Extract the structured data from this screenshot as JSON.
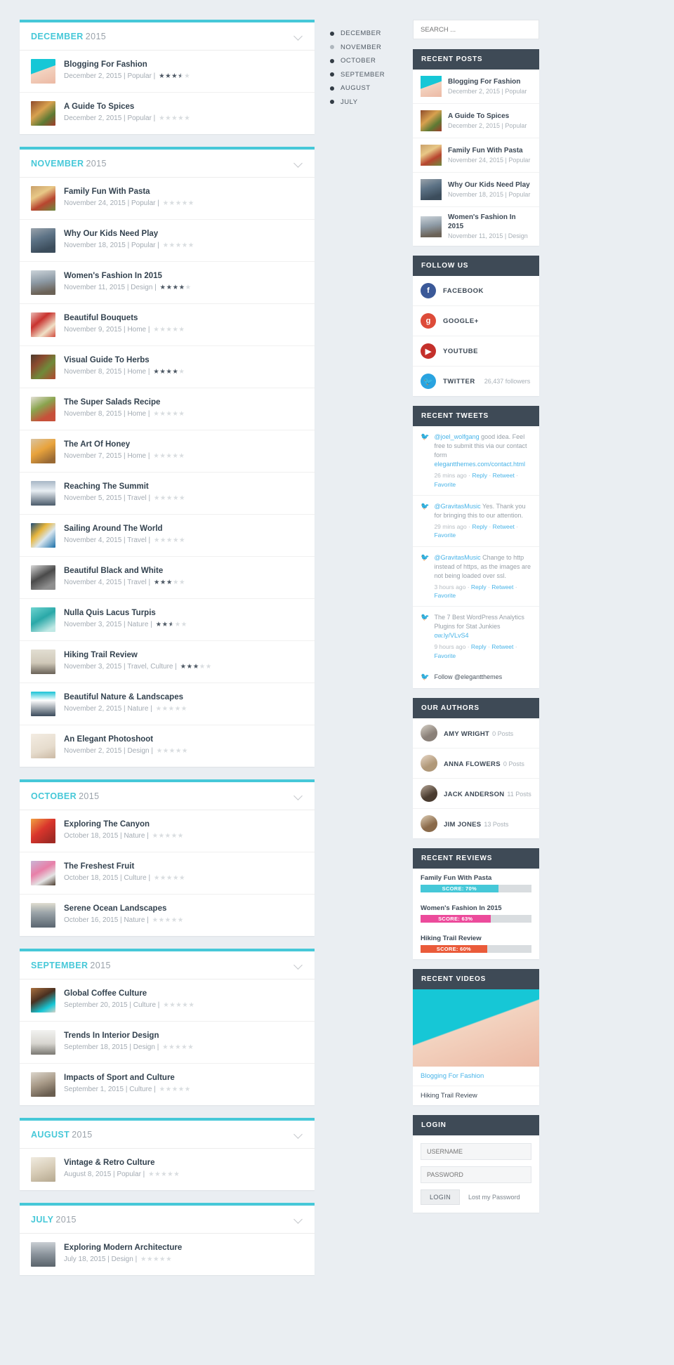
{
  "months": [
    {
      "month": "DECEMBER",
      "year": "2015",
      "posts": [
        {
          "title": "Blogging For Fashion",
          "date": "December 2, 2015",
          "cat": "Popular",
          "rating": 3.5,
          "img": "fashion"
        },
        {
          "title": "A Guide To Spices",
          "date": "December 2, 2015",
          "cat": "Popular",
          "rating": 0,
          "img": "spices"
        }
      ]
    },
    {
      "month": "NOVEMBER",
      "year": "2015",
      "posts": [
        {
          "title": "Family Fun With Pasta",
          "date": "November 24, 2015",
          "cat": "Popular",
          "rating": 0,
          "img": "pasta"
        },
        {
          "title": "Why Our Kids Need Play",
          "date": "November 18, 2015",
          "cat": "Popular",
          "rating": 0,
          "img": "kids"
        },
        {
          "title": "Women's Fashion In 2015",
          "date": "November 11, 2015",
          "cat": "Design",
          "rating": 4,
          "img": "womens"
        },
        {
          "title": "Beautiful Bouquets",
          "date": "November 9, 2015",
          "cat": "Home",
          "rating": 0,
          "img": "bouquets"
        },
        {
          "title": "Visual Guide To Herbs",
          "date": "November 8, 2015",
          "cat": "Home",
          "rating": 4,
          "img": "herbs"
        },
        {
          "title": "The Super Salads Recipe",
          "date": "November 8, 2015",
          "cat": "Home",
          "rating": 0,
          "img": "salads"
        },
        {
          "title": "The Art Of Honey",
          "date": "November 7, 2015",
          "cat": "Home",
          "rating": 0,
          "img": "honey"
        },
        {
          "title": "Reaching The Summit",
          "date": "November 5, 2015",
          "cat": "Travel",
          "rating": 0,
          "img": "summit"
        },
        {
          "title": "Sailing Around The World",
          "date": "November 4, 2015",
          "cat": "Travel",
          "rating": 0,
          "img": "sailing"
        },
        {
          "title": "Beautiful Black and White",
          "date": "November 4, 2015",
          "cat": "Travel",
          "rating": 3,
          "img": "bw"
        },
        {
          "title": "Nulla Quis Lacus Turpis",
          "date": "November 3, 2015",
          "cat": "Nature",
          "rating": 2.5,
          "img": "lacus"
        },
        {
          "title": "Hiking Trail Review",
          "date": "November 3, 2015",
          "cat": "Travel, Culture",
          "rating": 3,
          "img": "hiking"
        },
        {
          "title": "Beautiful Nature & Landscapes",
          "date": "November 2, 2015",
          "cat": "Nature",
          "rating": 0,
          "img": "nature"
        },
        {
          "title": "An Elegant Photoshoot",
          "date": "November 2, 2015",
          "cat": "Design",
          "rating": 0,
          "img": "elegant"
        }
      ]
    },
    {
      "month": "OCTOBER",
      "year": "2015",
      "posts": [
        {
          "title": "Exploring The Canyon",
          "date": "October 18, 2015",
          "cat": "Nature",
          "rating": 0,
          "img": "canyon"
        },
        {
          "title": "The Freshest Fruit",
          "date": "October 18, 2015",
          "cat": "Culture",
          "rating": 0,
          "img": "fruit"
        },
        {
          "title": "Serene Ocean Landscapes",
          "date": "October 16, 2015",
          "cat": "Nature",
          "rating": 0,
          "img": "ocean"
        }
      ]
    },
    {
      "month": "SEPTEMBER",
      "year": "2015",
      "posts": [
        {
          "title": "Global Coffee Culture",
          "date": "September 20, 2015",
          "cat": "Culture",
          "rating": 0,
          "img": "coffee"
        },
        {
          "title": "Trends In Interior Design",
          "date": "September 18, 2015",
          "cat": "Design",
          "rating": 0,
          "img": "interior"
        },
        {
          "title": "Impacts of Sport and Culture",
          "date": "September 1, 2015",
          "cat": "Culture",
          "rating": 0,
          "img": "sport"
        }
      ]
    },
    {
      "month": "AUGUST",
      "year": "2015",
      "posts": [
        {
          "title": "Vintage & Retro Culture",
          "date": "August 8, 2015",
          "cat": "Popular",
          "rating": 0,
          "img": "vintage"
        }
      ]
    },
    {
      "month": "JULY",
      "year": "2015",
      "posts": [
        {
          "title": "Exploring Modern Architecture",
          "date": "July 18, 2015",
          "cat": "Design",
          "rating": 0,
          "img": "architecture"
        }
      ]
    }
  ],
  "dotnav": [
    {
      "label": "DECEMBER",
      "active": true
    },
    {
      "label": "NOVEMBER",
      "active": false
    },
    {
      "label": "OCTOBER",
      "active": true
    },
    {
      "label": "SEPTEMBER",
      "active": true
    },
    {
      "label": "AUGUST",
      "active": true
    },
    {
      "label": "JULY",
      "active": true
    }
  ],
  "search": {
    "placeholder": "SEARCH ..."
  },
  "recent_posts": {
    "title": "RECENT POSTS",
    "items": [
      {
        "title": "Blogging For Fashion",
        "sub": "December 2, 2015 | Popular",
        "img": "fashion"
      },
      {
        "title": "A Guide To Spices",
        "sub": "December 2, 2015 | Popular",
        "img": "spices"
      },
      {
        "title": "Family Fun With Pasta",
        "sub": "November 24, 2015 | Popular",
        "img": "pasta"
      },
      {
        "title": "Why Our Kids Need Play",
        "sub": "November 18, 2015 | Popular",
        "img": "kids"
      },
      {
        "title": "Women's Fashion In 2015",
        "sub": "November 11, 2015 | Design",
        "img": "womens"
      }
    ]
  },
  "follow": {
    "title": "FOLLOW US",
    "items": [
      {
        "name": "FACEBOOK",
        "glyph": "f",
        "color": "#3b5998",
        "count": ""
      },
      {
        "name": "GOOGLE+",
        "glyph": "g",
        "color": "#dd4b39",
        "count": ""
      },
      {
        "name": "YOUTUBE",
        "glyph": "▶",
        "color": "#c4302b",
        "count": ""
      },
      {
        "name": "TWITTER",
        "glyph": "🐦",
        "color": "#29a3e0",
        "count": "26,437 followers"
      }
    ]
  },
  "tweets": {
    "title": "RECENT TWEETS",
    "items": [
      {
        "handle": "@joel_wolfgang",
        "text": " good idea. Feel free to submit this via our contact form ",
        "link": "elegantthemes.com/contact.html",
        "time": "26 mins ago"
      },
      {
        "handle": "@GravitasMusic",
        "text": " Yes. Thank you for bringing this to our attention.",
        "link": "",
        "time": "29 mins ago"
      },
      {
        "handle": "@GravitasMusic",
        "text": " Change to http instead of https, as the images are not being loaded over ssl.",
        "link": "",
        "time": "3 hours ago"
      },
      {
        "handle": "",
        "text": "The 7 Best WordPress Analytics Plugins for Stat Junkies ",
        "link": "ow.ly/VLvS4",
        "time": "9 hours ago"
      }
    ],
    "actions": [
      "Reply",
      "Retweet",
      "Favorite"
    ],
    "footer": "Follow @elegantthemes"
  },
  "authors": {
    "title": "OUR AUTHORS",
    "items": [
      {
        "name": "AMY WRIGHT",
        "posts": "0 Posts",
        "img": "amy"
      },
      {
        "name": "ANNA FLOWERS",
        "posts": "0 Posts",
        "img": "anna"
      },
      {
        "name": "JACK ANDERSON",
        "posts": "11 Posts",
        "img": "jack"
      },
      {
        "name": "JIM JONES",
        "posts": "13 Posts",
        "img": "jim"
      }
    ]
  },
  "reviews": {
    "title": "RECENT REVIEWS",
    "items": [
      {
        "title": "Family Fun With Pasta",
        "score": 70,
        "label": "SCORE: 70%",
        "color": "#46c8d8"
      },
      {
        "title": "Women's Fashion In 2015",
        "score": 63,
        "label": "SCORE: 63%",
        "color": "#ec4b9b"
      },
      {
        "title": "Hiking Trail Review",
        "score": 60,
        "label": "SCORE: 60%",
        "color": "#ea5b3a"
      }
    ]
  },
  "videos": {
    "title": "RECENT VIDEOS",
    "items": [
      {
        "label": "Blogging For Fashion",
        "active": true
      },
      {
        "label": "Hiking Trail Review",
        "active": false
      }
    ]
  },
  "login": {
    "title": "LOGIN",
    "username_placeholder": "USERNAME",
    "password_placeholder": "PASSWORD",
    "button": "LOGIN",
    "lost": "Lost my Password"
  }
}
